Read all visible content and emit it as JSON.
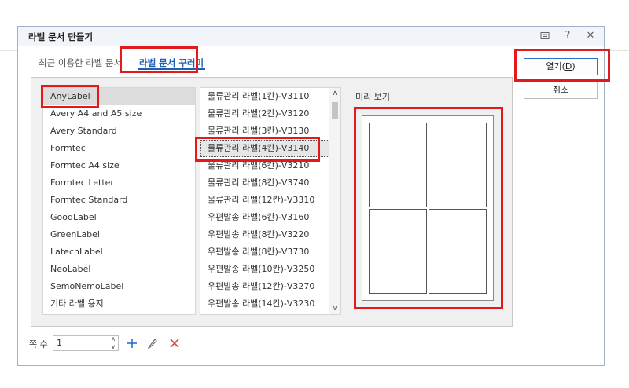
{
  "dialog": {
    "title": "라벨 문서 만들기",
    "icons": [
      "feedback-icon",
      "help-icon",
      "close-icon"
    ],
    "help_glyph": "?",
    "close_glyph": "✕"
  },
  "tabs": [
    {
      "label": "최근 이용한 라벨 문서",
      "active": false
    },
    {
      "label": "라벨 문서 꾸러미",
      "active": true
    }
  ],
  "vendors": [
    "AnyLabel",
    "Avery A4 and A5 size",
    "Avery Standard",
    "Formtec",
    "Formtec A4 size",
    "Formtec Letter",
    "Formtec Standard",
    "GoodLabel",
    "GreenLabel",
    "LatechLabel",
    "NeoLabel",
    "SemoNemoLabel",
    "기타 라벨 용지"
  ],
  "selected_vendor": "AnyLabel",
  "labels": [
    "물류관리 라벨(1칸)-V3110",
    "물류관리 라벨(2칸)-V3120",
    "물류관리 라벨(3칸)-V3130",
    "물류관리 라벨(4칸)-V3140",
    "물류관리 라벨(6칸)-V3210",
    "물류관리 라벨(8칸)-V3740",
    "물류관리 라벨(12칸)-V3310",
    "우편발송 라벨(6칸)-V3160",
    "우편발송 라벨(8칸)-V3220",
    "우편발송 라벨(8칸)-V3730",
    "우편발송 라벨(10칸)-V3250",
    "우편발송 라벨(12칸)-V3270",
    "우편발송 라벨(14칸)-V3230"
  ],
  "selected_label": "물류관리 라벨(4칸)-V3140",
  "scroll_up": "∧",
  "scroll_down": "∨",
  "preview": {
    "title": "미리 보기",
    "grid": {
      "cols": 2,
      "rows": 2
    }
  },
  "buttons": {
    "open_text": "열기(",
    "open_key": "D",
    "open_close": ")",
    "cancel": "취소"
  },
  "count": {
    "label": "쪽 수",
    "value": "1",
    "spin_up": "∧",
    "spin_down": "∨"
  },
  "colors": {
    "accent": "#1e5fb4",
    "highlight": "#e31a1a",
    "delete": "#e0463c",
    "add": "#2c6fd0"
  }
}
